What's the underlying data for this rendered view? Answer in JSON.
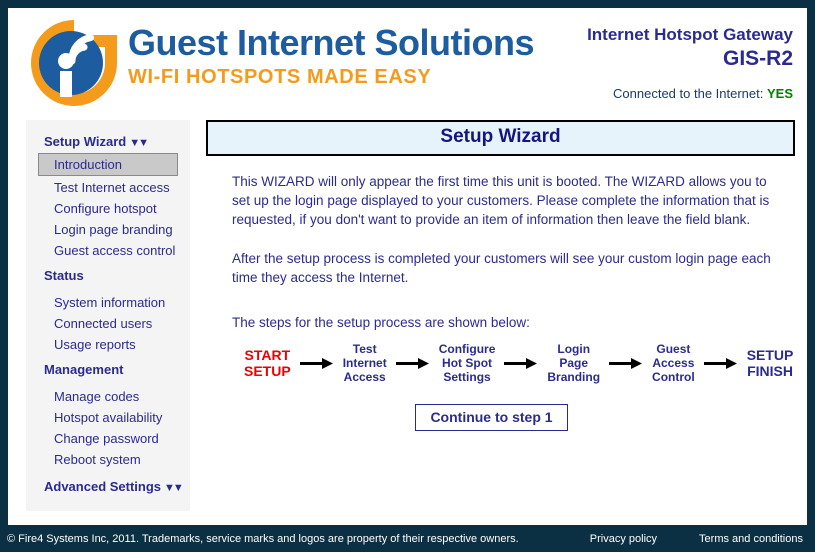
{
  "brand": {
    "logo_icon": "guest-internet-globe-wifi-logo",
    "title": "Guest Internet Solutions",
    "tagline": "WI-FI HOTSPOTS MADE EASY",
    "colors": {
      "blue": "#1d5c9e",
      "orange": "#f59b1b",
      "navy": "#2b2b8f",
      "frame": "#0b3044"
    }
  },
  "header": {
    "product_line1": "Internet Hotspot Gateway",
    "product_line2": "GIS-R2",
    "status_label": "Connected to the Internet:",
    "status_value": "YES",
    "status_color": "#008000"
  },
  "sidebar": {
    "groups": [
      {
        "title": "Setup Wizard",
        "has_chevron": true,
        "chevron_icon": "chevron-double-down-icon",
        "items": [
          {
            "label": "Introduction",
            "selected": true
          },
          {
            "label": "Test Internet access",
            "selected": false
          },
          {
            "label": "Configure hotspot",
            "selected": false
          },
          {
            "label": "Login page branding",
            "selected": false
          },
          {
            "label": "Guest access control",
            "selected": false
          }
        ]
      },
      {
        "title": "Status",
        "has_chevron": false,
        "items": [
          {
            "label": "System information",
            "selected": false
          },
          {
            "label": "Connected users",
            "selected": false
          },
          {
            "label": "Usage reports",
            "selected": false
          }
        ]
      },
      {
        "title": "Management",
        "has_chevron": false,
        "items": [
          {
            "label": "Manage codes",
            "selected": false
          },
          {
            "label": "Hotspot availability",
            "selected": false
          },
          {
            "label": "Change password",
            "selected": false
          },
          {
            "label": "Reboot system",
            "selected": false
          }
        ]
      },
      {
        "title": "Advanced Settings",
        "has_chevron": true,
        "chevron_icon": "chevron-double-down-icon",
        "items": []
      }
    ]
  },
  "main": {
    "page_title": "Setup Wizard",
    "paragraphs": [
      "This WIZARD will only appear the first time this unit is booted. The WIZARD allows you to set up the login page displayed to your customers. Please complete the information that is requested, if you don't want to provide an item of information then leave the field blank.",
      "After the setup process is completed your customers will see your custom login page each time they access the Internet.",
      "The steps for the setup process are shown below:"
    ],
    "flow_steps": [
      {
        "lines": [
          "START",
          "SETUP"
        ],
        "kind": "start"
      },
      {
        "lines": [
          "Test",
          "Internet",
          "Access"
        ],
        "kind": "step"
      },
      {
        "lines": [
          "Configure",
          "Hot Spot",
          "Settings"
        ],
        "kind": "step"
      },
      {
        "lines": [
          "Login",
          "Page",
          "Branding"
        ],
        "kind": "step"
      },
      {
        "lines": [
          "Guest",
          "Access",
          "Control"
        ],
        "kind": "step"
      },
      {
        "lines": [
          "SETUP",
          "FINISH"
        ],
        "kind": "end"
      }
    ],
    "continue_button": "Continue to step 1"
  },
  "footer": {
    "copyright": "© Fire4 Systems Inc, 2011. Trademarks, service marks and logos are property of their respective owners.",
    "links": [
      {
        "label": "Privacy policy"
      },
      {
        "label": "Terms and conditions"
      }
    ]
  }
}
